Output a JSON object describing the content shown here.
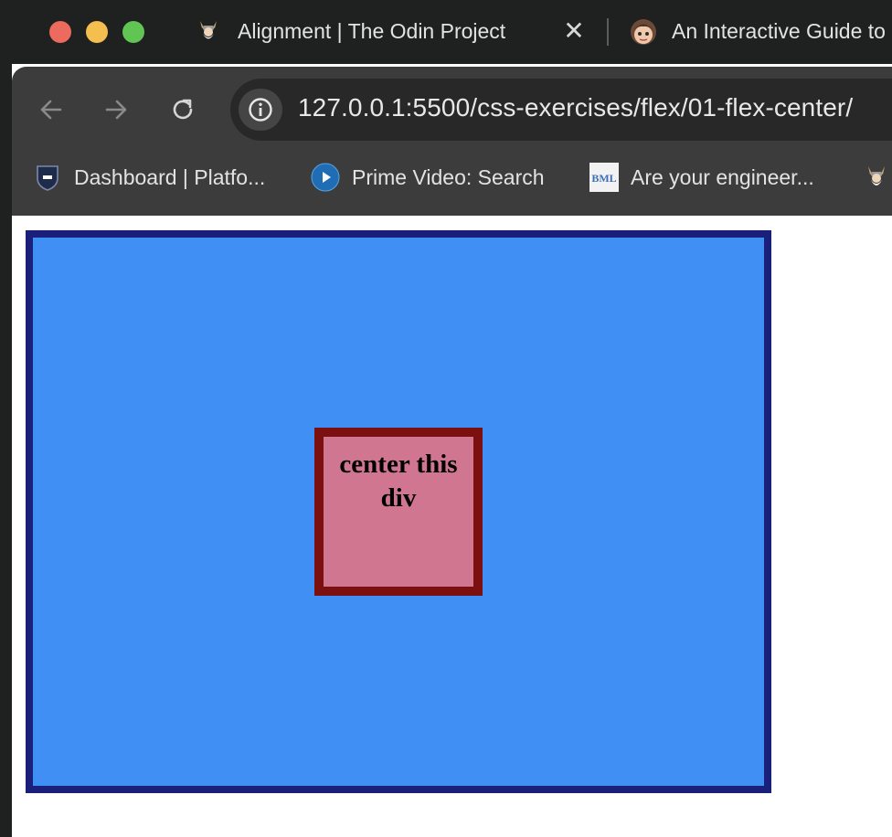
{
  "browser": {
    "tabs": [
      {
        "title": "Alignment | The Odin Project",
        "favicon": "odin-viking-icon",
        "active": true
      },
      {
        "title": "An Interactive Guide to Flexbox",
        "favicon": "avatar-face-icon",
        "active": false
      }
    ],
    "address_bar": {
      "url": "127.0.0.1:5500/css-exercises/flex/01-flex-center/",
      "site_info_icon": "info-icon"
    },
    "navigation": {
      "back_icon": "arrow-left-icon",
      "forward_icon": "arrow-right-icon",
      "reload_icon": "reload-icon"
    },
    "bookmarks": [
      {
        "label": "Dashboard | Platfo...",
        "icon": "shield-icon"
      },
      {
        "label": "Prime Video: Search",
        "icon": "play-circle-icon"
      },
      {
        "label": "Are your engineer...",
        "icon": "bml-logo-icon"
      },
      {
        "label": "",
        "icon": "odin-viking-icon"
      }
    ]
  },
  "page": {
    "center_box_text": "center this div"
  },
  "colors": {
    "container_background": "#3f8ff5",
    "container_border": "#1a1f7a",
    "box_background": "#d07690",
    "box_border": "#7c1010",
    "chrome_dark": "#1f2020",
    "toolbar": "#3c3c3c"
  }
}
